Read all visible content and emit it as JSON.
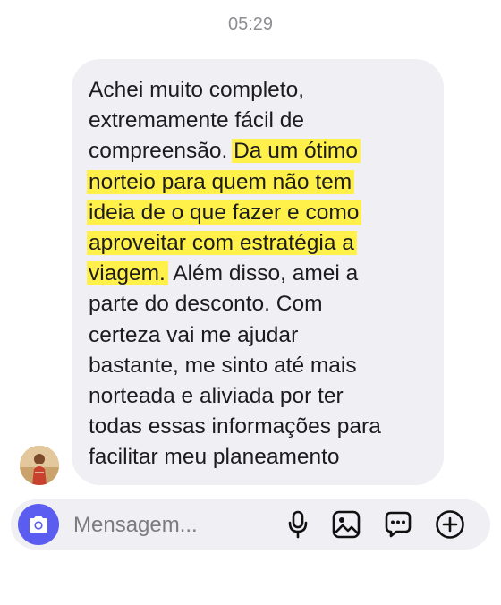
{
  "chat": {
    "timestamp": "05:29",
    "message": {
      "lines": [
        {
          "pre": "Achei muito completo,",
          "hl": "",
          "post": ""
        },
        {
          "pre": "extremamente fácil de",
          "hl": "",
          "post": ""
        },
        {
          "pre": "compreensão.",
          "hl": "Da um ótimo",
          "post": ""
        },
        {
          "pre": "",
          "hl": "norteio para quem não tem",
          "post": ""
        },
        {
          "pre": "",
          "hl": "ideia de o que fazer e como",
          "post": ""
        },
        {
          "pre": "",
          "hl": "aproveitar com estratégia a",
          "post": ""
        },
        {
          "pre": "",
          "hl": "viagem.",
          "post": "Além disso, amei a"
        },
        {
          "pre": "parte do desconto. Com",
          "hl": "",
          "post": ""
        },
        {
          "pre": "certeza vai me ajudar",
          "hl": "",
          "post": ""
        },
        {
          "pre": "bastante, me sinto até mais",
          "hl": "",
          "post": ""
        },
        {
          "pre": "norteada e aliviada por ter",
          "hl": "",
          "post": ""
        },
        {
          "pre": "todas essas informações para",
          "hl": "",
          "post": ""
        },
        {
          "pre": "facilitar meu planeamento",
          "hl": "",
          "post": ""
        }
      ],
      "highlight_color": "#fff04a",
      "bubble_color": "#efeff4"
    }
  },
  "composer": {
    "placeholder": "Mensagem...",
    "accent_color": "#5b5cf0",
    "icons": [
      "camera-icon",
      "microphone-icon",
      "image-icon",
      "sticker-icon",
      "plus-icon"
    ]
  }
}
